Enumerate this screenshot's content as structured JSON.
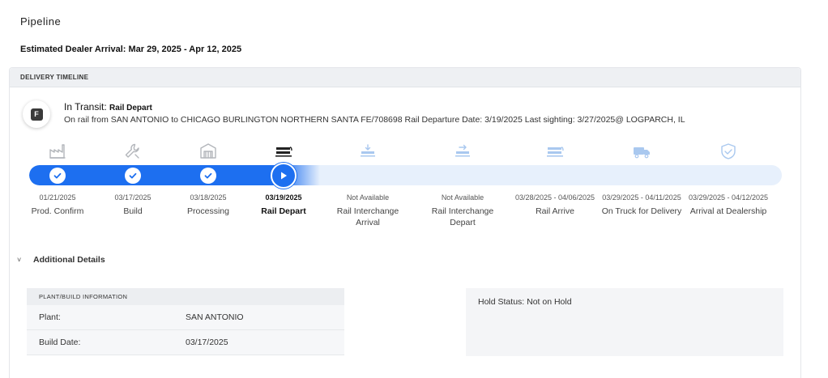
{
  "page": {
    "title": "Pipeline",
    "eta": "Estimated Dealer Arrival: Mar 29, 2025 - Apr 12, 2025"
  },
  "timeline": {
    "header": "DELIVERY TIMELINE",
    "avatar_letter": "F",
    "status_prefix": "In Transit:",
    "status_stage": "Rail Depart",
    "status_description": "On rail from SAN ANTONIO to CHICAGO BURLINGTON NORTHERN SANTA FE/708698 Rail Departure Date: 3/19/2025 Last sighting: 3/27/2025@ LOGPARCH, IL",
    "progress_fraction": 0.375,
    "colors": {
      "complete": "#1d6ff0",
      "pending": "#e7f0fc",
      "icon_done": "#b3b6bb",
      "icon_current": "#222222",
      "icon_future": "#a9c8ef"
    },
    "stages": [
      {
        "icon": "factory-icon",
        "date": "01/21/2025",
        "name": "Prod. Confirm",
        "state": "complete"
      },
      {
        "icon": "wrench-icon",
        "date": "03/17/2025",
        "name": "Build",
        "state": "complete"
      },
      {
        "icon": "processing-icon",
        "date": "03/18/2025",
        "name": "Processing",
        "state": "complete"
      },
      {
        "icon": "train-icon",
        "date": "03/19/2025",
        "name": "Rail Depart",
        "state": "current"
      },
      {
        "icon": "rail-arrival-icon",
        "date": "Not Available",
        "name": "Rail Interchange Arrival",
        "state": "future"
      },
      {
        "icon": "rail-depart-icon",
        "date": "Not Available",
        "name": "Rail Interchange Depart",
        "state": "future"
      },
      {
        "icon": "train-icon",
        "date": "03/28/2025 - 04/06/2025",
        "name": "Rail Arrive",
        "state": "future"
      },
      {
        "icon": "truck-icon",
        "date": "03/29/2025 - 04/11/2025",
        "name": "On Truck for Delivery",
        "state": "future"
      },
      {
        "icon": "shield-check-icon",
        "date": "03/29/2025 - 04/12/2025",
        "name": "Arrival at Dealership",
        "state": "future"
      }
    ]
  },
  "details": {
    "toggle_label": "Additional Details",
    "chevron": "˅",
    "plant": {
      "header": "PLANT/BUILD INFORMATION",
      "rows": [
        {
          "label": "Plant:",
          "value": "SAN ANTONIO"
        },
        {
          "label": "Build Date:",
          "value": "03/17/2025"
        }
      ]
    },
    "hold_status": "Hold Status: Not on Hold"
  }
}
